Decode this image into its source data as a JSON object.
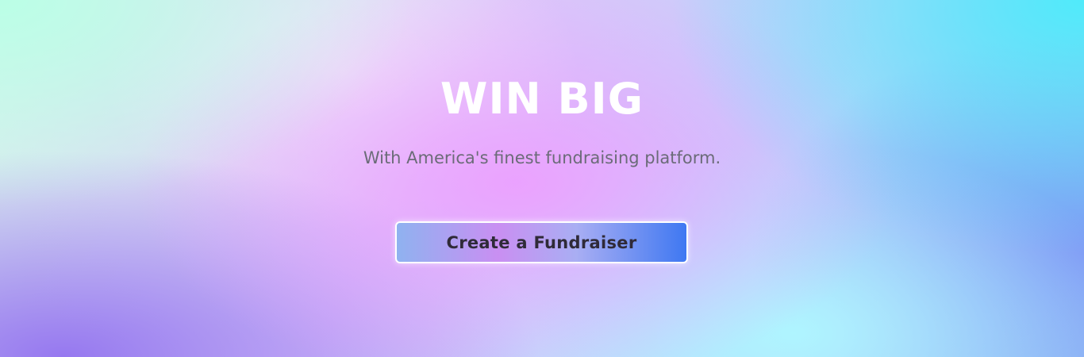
{
  "hero": {
    "title": "WIN BIG",
    "subtitle": "With America's finest fundraising platform.",
    "cta_label": "Create a Fundraiser"
  },
  "colors": {
    "title": "#ffffff",
    "subtitle": "#6b6b78",
    "button_text": "#2f2a38",
    "button_gradient_start": "#8fb2f0",
    "button_gradient_mid": "#c98ff2",
    "button_gradient_end": "#3f78f2"
  }
}
